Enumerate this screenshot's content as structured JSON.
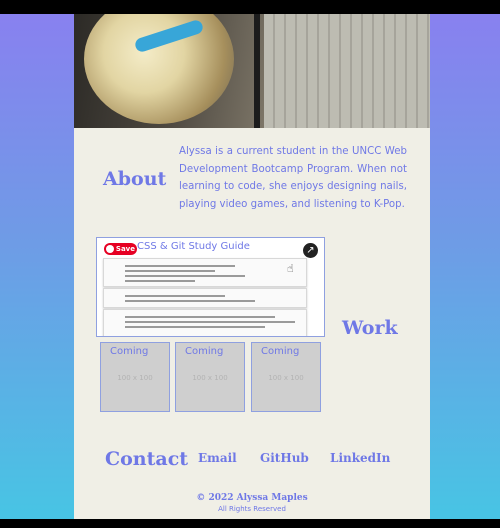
{
  "about": {
    "title": "About",
    "text": "Alyssa is a current student in the UNCC Web Development Bootcamp Program. When not learning to code, she enjoys designing nails, playing video games, and listening to K-Pop."
  },
  "work": {
    "title": "Work",
    "featured": {
      "title": "CSS & Git Study Guide",
      "save_label": "Save",
      "icons": {
        "save": "pinterest-save-icon",
        "share": "share-icon",
        "cursor": "hand-cursor-icon"
      }
    },
    "placeholders": [
      {
        "label": "Coming",
        "size": "100 x 100"
      },
      {
        "label": "Coming",
        "size": "100 x 100"
      },
      {
        "label": "Coming",
        "size": "100 x 100"
      }
    ]
  },
  "contact": {
    "title": "Contact",
    "links": [
      "Email",
      "GitHub",
      "LinkedIn"
    ]
  },
  "footer": {
    "copyright": "© 2022 Alyssa Maples",
    "rights": "All Rights Reserved"
  },
  "colors": {
    "accent": "#6f78e6",
    "page_bg": "#f0efe6",
    "save_red": "#e60023"
  }
}
